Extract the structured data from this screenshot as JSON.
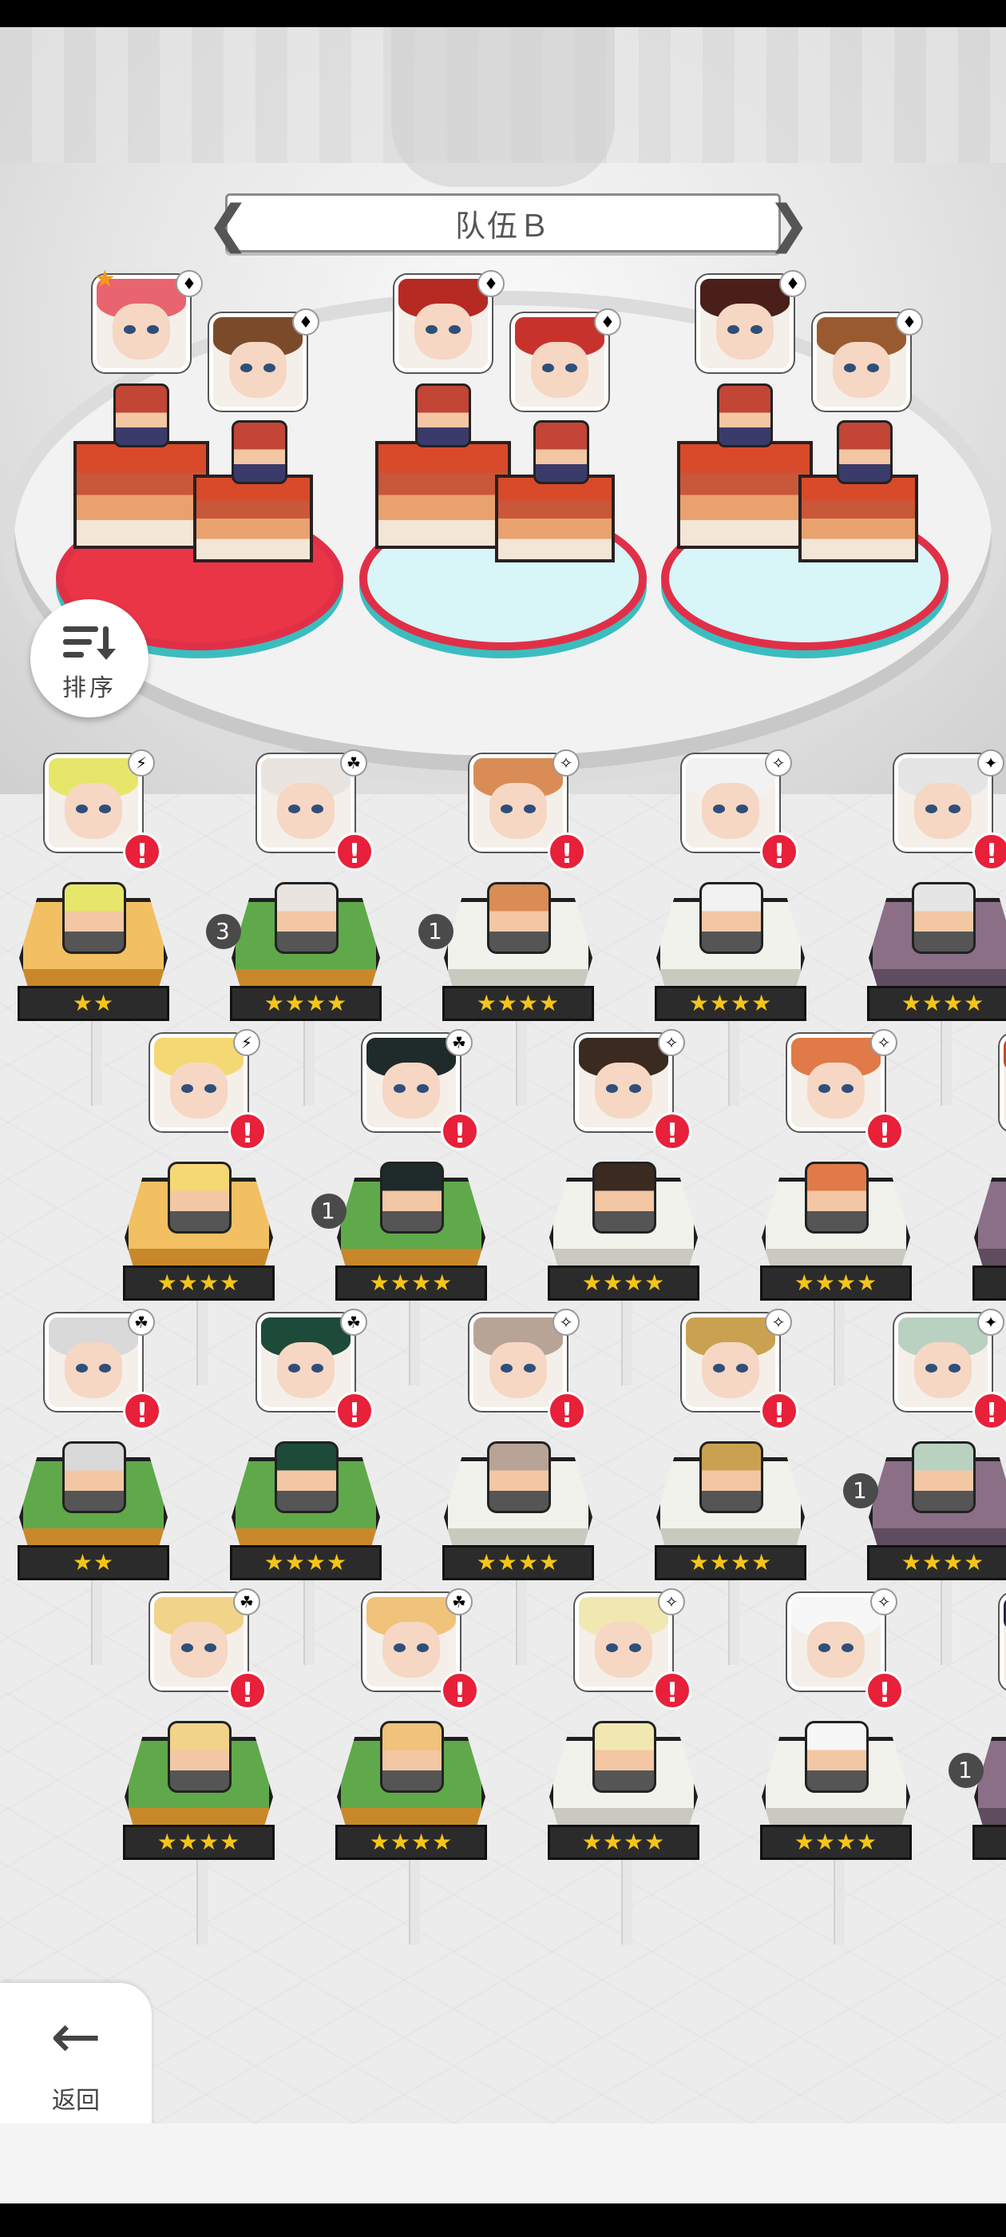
{
  "team": {
    "title": "队伍Ｂ",
    "prev": "❮",
    "next": "❯"
  },
  "sort": {
    "label": "排序"
  },
  "back": {
    "label": "返回",
    "arrow": "←"
  },
  "colors": {
    "accent_red": "#e8203a",
    "star": "#f5c518",
    "pad_red": "#ea3547",
    "pad_cyan": "#d8f5f7"
  },
  "formation": [
    {
      "attribute": "♦",
      "leader": "★",
      "hair": "#e8646e"
    },
    {
      "attribute": "♦",
      "hair": "#7b4a2b"
    },
    {
      "attribute": "♦",
      "hair": "#b52a22"
    },
    {
      "attribute": "♦",
      "hair": "#c8322c"
    },
    {
      "attribute": "♦",
      "hair": "#4a1f1a"
    },
    {
      "attribute": "♦",
      "hair": "#9a5a30"
    }
  ],
  "roster": {
    "rows": [
      [
        {
          "stars": "★★",
          "attr": "⚡",
          "hair": "#e6e66a",
          "pedestal": "gold",
          "alert": "!"
        },
        {
          "stars": "★★★★",
          "attr": "☘",
          "hair": "#e9e4e0",
          "pedestal": "green",
          "alert": "!",
          "stack": "3"
        },
        {
          "stars": "★★★★",
          "attr": "✧",
          "hair": "#d98c56",
          "pedestal": "grey",
          "alert": "!",
          "stack": "1"
        },
        {
          "stars": "★★★★",
          "attr": "✧",
          "hair": "#f2f2f2",
          "pedestal": "grey",
          "alert": "!"
        },
        {
          "stars": "★★★★",
          "attr": "✦",
          "hair": "#e5e5e5",
          "pedestal": "purple",
          "alert": "!"
        }
      ],
      [
        {
          "stars": "★★★★",
          "attr": "⚡",
          "hair": "#f4d873",
          "pedestal": "gold",
          "alert": "!"
        },
        {
          "stars": "★★★★",
          "attr": "☘",
          "hair": "#1f2a2a",
          "pedestal": "green",
          "alert": "!",
          "stack": "1"
        },
        {
          "stars": "★★★★",
          "attr": "✧",
          "hair": "#3a2a20",
          "pedestal": "grey",
          "alert": "!"
        },
        {
          "stars": "★★★★",
          "attr": "✧",
          "hair": "#e07a48",
          "pedestal": "grey",
          "alert": "!"
        },
        {
          "stars": "★★★★",
          "attr": "✦",
          "hair": "#c24a22",
          "pedestal": "purple",
          "alert": "!"
        }
      ],
      [
        {
          "stars": "★★",
          "attr": "☘",
          "hair": "#d9d9d9",
          "pedestal": "green",
          "alert": "!"
        },
        {
          "stars": "★★★★",
          "attr": "☘",
          "hair": "#1e4a3a",
          "pedestal": "green",
          "alert": "!"
        },
        {
          "stars": "★★★★",
          "attr": "✧",
          "hair": "#b8a496",
          "pedestal": "grey",
          "alert": "!"
        },
        {
          "stars": "★★★★",
          "attr": "✧",
          "hair": "#c9a150",
          "pedestal": "grey",
          "alert": "!"
        },
        {
          "stars": "★★★★",
          "attr": "✦",
          "hair": "#b9d1c0",
          "pedestal": "purple",
          "alert": "!",
          "stack": "1"
        }
      ],
      [
        {
          "stars": "★★★★",
          "attr": "☘",
          "hair": "#f1d38a",
          "pedestal": "green",
          "alert": "!"
        },
        {
          "stars": "★★★★",
          "attr": "☘",
          "hair": "#f0c27a",
          "pedestal": "green",
          "alert": "!"
        },
        {
          "stars": "★★★★",
          "attr": "✧",
          "hair": "#f0e8b0",
          "pedestal": "grey",
          "alert": "!"
        },
        {
          "stars": "★★★★",
          "attr": "✧",
          "hair": "#f7f7f7",
          "pedestal": "grey",
          "alert": "!"
        },
        {
          "stars": "★★★★",
          "attr": "✦",
          "hair": "#2a2440",
          "pedestal": "purple",
          "alert": "!",
          "stack": "1"
        }
      ]
    ]
  }
}
